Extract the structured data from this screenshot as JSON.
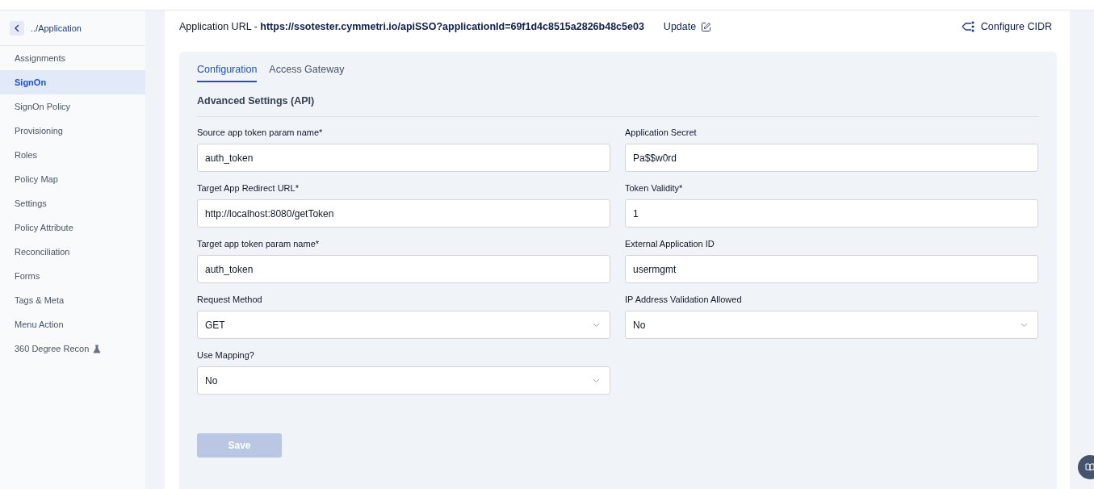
{
  "sidebar": {
    "back_label": "../Application",
    "items": [
      {
        "label": "Assignments",
        "selected": false,
        "beta": false
      },
      {
        "label": "SignOn",
        "selected": true,
        "beta": false
      },
      {
        "label": "SignOn Policy",
        "selected": false,
        "beta": false
      },
      {
        "label": "Provisioning",
        "selected": false,
        "beta": false
      },
      {
        "label": "Roles",
        "selected": false,
        "beta": false
      },
      {
        "label": "Policy Map",
        "selected": false,
        "beta": false
      },
      {
        "label": "Settings",
        "selected": false,
        "beta": false
      },
      {
        "label": "Policy Attribute",
        "selected": false,
        "beta": false
      },
      {
        "label": "Reconciliation",
        "selected": false,
        "beta": false
      },
      {
        "label": "Forms",
        "selected": false,
        "beta": false
      },
      {
        "label": "Tags & Meta",
        "selected": false,
        "beta": false
      },
      {
        "label": "Menu Action",
        "selected": false,
        "beta": false
      },
      {
        "label": "360 Degree Recon",
        "selected": false,
        "beta": true
      }
    ]
  },
  "header": {
    "url_label": "Application URL -",
    "url": "https://ssotester.cymmetri.io/apiSSO?applicationId=69f1d4c8515a2826b48c5e03",
    "update": "Update",
    "configure": "Configure CIDR"
  },
  "tabs": [
    {
      "label": "Configuration",
      "selected": true
    },
    {
      "label": "Access Gateway",
      "selected": false
    }
  ],
  "section_title": "Advanced Settings (API)",
  "fields": [
    {
      "label": "Source app token param name*",
      "value": "auth_token",
      "kind": "text"
    },
    {
      "label": "Application Secret",
      "value": "Pa$$w0rd",
      "kind": "text"
    },
    {
      "label": "Target App Redirect URL*",
      "value": "http://localhost:8080/getToken",
      "kind": "text"
    },
    {
      "label": "Token Validity*",
      "value": "1",
      "kind": "text"
    },
    {
      "label": "Target app token param name*",
      "value": "auth_token",
      "kind": "text"
    },
    {
      "label": "External Application ID",
      "value": "usermgmt",
      "kind": "text"
    },
    {
      "label": "Request Method",
      "value": "GET",
      "kind": "select"
    },
    {
      "label": "IP Address Validation Allowed",
      "value": "No",
      "kind": "select"
    },
    {
      "label": "Use Mapping?",
      "value": "No",
      "kind": "select"
    }
  ],
  "save": {
    "label": "Save",
    "disabled": true
  }
}
